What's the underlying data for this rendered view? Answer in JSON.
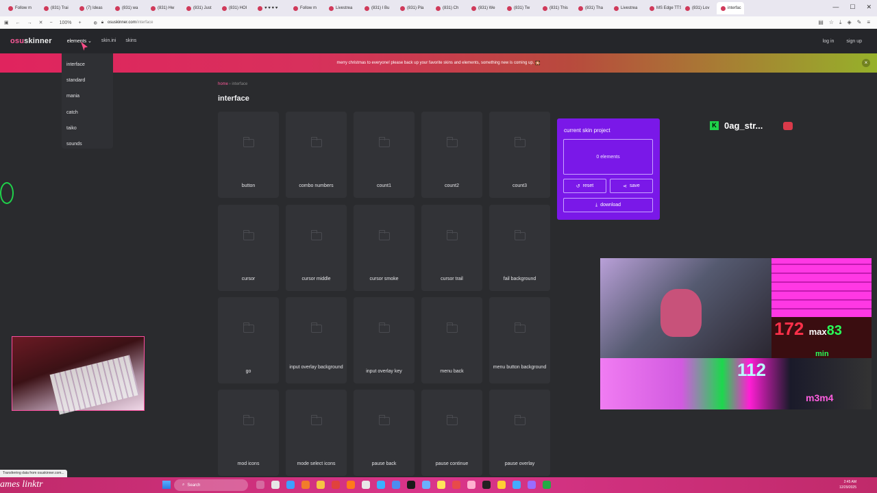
{
  "browser": {
    "tabs": [
      "Follow m",
      "(831) Trai",
      "(7) Ideas",
      "(831) wa",
      "(831) Hw",
      "(831) Just",
      "(831) HOI",
      "♥ ♥ ♥ ♥",
      "Follow m",
      "Livestrea",
      "(831) I Bu",
      "(831) Pla",
      "(831) Ch",
      "(831) We",
      "(831) Tw",
      "(831) This",
      "(831) Tha",
      "Livestrea",
      "MS Edge TTS",
      "(831) Lov",
      "interfac"
    ],
    "zoom": "100%",
    "url_host": "osuskinner.com",
    "url_path": "/interface",
    "status_text": "Transferring data from osuskinner.com..."
  },
  "site": {
    "logo_part1": "osu",
    "logo_part2": "skinner",
    "nav": [
      {
        "label": "elements"
      },
      {
        "label": "skin.ini"
      },
      {
        "label": "skins"
      }
    ],
    "auth": {
      "login": "log in",
      "signup": "sign up"
    },
    "banner": "merry christmas to everyone! please back up your favorite skins and elements, something new is coming up.",
    "banner_close": "×",
    "dropdown": [
      "interface",
      "standard",
      "mania",
      "catch",
      "taiko",
      "sounds"
    ],
    "breadcrumb": {
      "home": "home",
      "sep": " › ",
      "current": "interface"
    },
    "title": "interface"
  },
  "cards": [
    {
      "label": "button"
    },
    {
      "label": "combo numbers"
    },
    {
      "label": "count1"
    },
    {
      "label": "count2"
    },
    {
      "label": "count3"
    },
    {
      "label": "cursor"
    },
    {
      "label": "cursor middle"
    },
    {
      "label": "cursor smoke"
    },
    {
      "label": "cursor trail"
    },
    {
      "label": "fail background"
    },
    {
      "label": "go"
    },
    {
      "label": "input overlay background"
    },
    {
      "label": "input overlay key"
    },
    {
      "label": "menu back"
    },
    {
      "label": "menu button background"
    },
    {
      "label": "mod icons"
    },
    {
      "label": "mode select icons"
    },
    {
      "label": "pause back"
    },
    {
      "label": "pause continue"
    },
    {
      "label": "pause overlay"
    }
  ],
  "project": {
    "title": "current skin project",
    "count": "0 elements",
    "reset": "reset",
    "save": "save",
    "download": "download"
  },
  "stream": {
    "name": "0ag_str...",
    "overlay_number": "112",
    "overlay_text": "m3m4",
    "hud_left": "172",
    "hud_max": "max",
    "hud_right": "83",
    "hud_min": "min",
    "linktree": "ames linktr"
  },
  "taskbar": {
    "search": "Search",
    "time": "2:45 AM",
    "date": "12/29/2025"
  },
  "colors": {
    "accent_pink": "#ff5a9a",
    "project_purple": "#7a18e8",
    "taskbar_pink": "#d9358a"
  }
}
